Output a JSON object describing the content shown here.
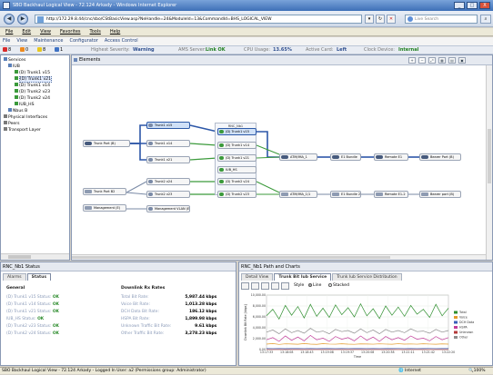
{
  "window": {
    "title": "SBO Backhaul Logical View - 72.124 Arkady - Windows Internet Explorer",
    "url": "http://172.29.8.44/cnc/sbo/CStBasicView.asp?NeHandle=24&ModuleId=13&CommandId=BHS_LOGICAL_VIEW",
    "search_placeholder": "Live Search",
    "controls": [
      "_",
      "□",
      "X"
    ]
  },
  "ie_menu": [
    "File",
    "Edit",
    "View",
    "Favorites",
    "Tools",
    "Help"
  ],
  "app_menu": [
    "File",
    "View",
    "Maintenance",
    "Configurator",
    "Access Control"
  ],
  "alarms": {
    "counts": [
      "8",
      "0",
      "8",
      "1"
    ],
    "highest_severity_label": "Highest Severity:",
    "highest_severity": "Warning",
    "ams_label": "AMS Server:",
    "ams_value": "Link OK",
    "cpu_label": "CPU Usage:",
    "cpu_value": "13.65%",
    "card_label": "Active Card:",
    "card_value": "Left",
    "device_label": "Clock Device:",
    "device_value": "Internal"
  },
  "tree": [
    {
      "label": "Services",
      "indent": 0
    },
    {
      "label": "IUB",
      "indent": 1
    },
    {
      "label": "(D) Trunk1 v15",
      "indent": 2
    },
    {
      "label": "(D) Trunk1 v21",
      "indent": 2,
      "selected": true
    },
    {
      "label": "(D) Trunk1 v14",
      "indent": 2
    },
    {
      "label": "(D) Trunk2 v23",
      "indent": 2
    },
    {
      "label": "(D) Trunk2 v24",
      "indent": 2
    },
    {
      "label": "IUB_HS",
      "indent": 2
    },
    {
      "label": "Nbus B",
      "indent": 1
    },
    {
      "label": "Physical Interfaces",
      "indent": 0
    },
    {
      "label": "Peers",
      "indent": 0
    },
    {
      "label": "Transport Layer",
      "indent": 0
    }
  ],
  "elements": {
    "title": "Elements",
    "cluster_title": "RNC_Nb1",
    "toolbar_icons": [
      "zoom-in-icon",
      "zoom-out-icon",
      "fit-icon",
      "layout-icon",
      "print-icon",
      "export-icon"
    ],
    "nodes": {
      "port_left_1": "Trunk Port (B)",
      "port_left_2": "Trunk Port B2",
      "mgmt": "Management (E)",
      "t1": "Trunk1 v15",
      "t2": "Trunk1 v14",
      "t3": "Trunk1 v21",
      "t4": "Trunk2 v24",
      "t5": "Trunk2 v23",
      "mgmt_vlan": "Management VLAN (E)",
      "c1": "(D) Trunk1 v15",
      "c2": "(D) Trunk1 v14",
      "c3": "(D) Trunk1 v21",
      "c4": "IUB_HS",
      "c5": "(D) Trunk2 v24",
      "c6": "(D) Trunk2 v23",
      "r1": "ATM/IMA_1",
      "r2": "E1 Bundle",
      "r3": "Remote E1",
      "r4": "Bearer Port (B)",
      "r5": "ATM/IMA_1/1",
      "r6": "E1 Bundle 2",
      "r7": "Remote E1-2",
      "r8": "Bearer port (B)"
    }
  },
  "status_panel": {
    "title": "RNC_Nb1 Status",
    "tabs": [
      "Alarms",
      "Status"
    ],
    "general_header": "General",
    "downlink_header": "Downlink Rx Rates",
    "general": [
      {
        "label": "(D) Trunk1 v15 Status:",
        "value": "OK"
      },
      {
        "label": "(D) Trunk1 v14 Status:",
        "value": "OK"
      },
      {
        "label": "(D) Trunk1 v21 Status:",
        "value": "OK"
      },
      {
        "label": "IUB_HS Status:",
        "value": "OK"
      },
      {
        "label": "(D) Trunk2 v23 Status:",
        "value": "OK"
      },
      {
        "label": "(D) Trunk2 v24 Status:",
        "value": "OK"
      }
    ],
    "downlink": [
      {
        "label": "Total Bit Rate:",
        "value": "5,987.44",
        "unit": "kbps"
      },
      {
        "label": "Voice Bit Rate:",
        "value": "1,013.28",
        "unit": "kbps"
      },
      {
        "label": "DCH Data Bit Rate:",
        "value": "186.12",
        "unit": "kbps"
      },
      {
        "label": "HSPA Bit Rate:",
        "value": "1,899.98",
        "unit": "kbps"
      },
      {
        "label": "Unknown Traffic Bit Rate:",
        "value": "9.61",
        "unit": "kbps"
      },
      {
        "label": "Other Traffic Bit Rate:",
        "value": "3,278.23",
        "unit": "kbps"
      }
    ]
  },
  "path_panel": {
    "title": "RNC_Nb1 Path and Charts",
    "tabs": [
      "Detail View",
      "Trunk Bit Iub Service",
      "Trunk Iub Service Distribution"
    ],
    "style_label": "Style",
    "line_label": "Line",
    "stacked_label": "Stacked"
  },
  "statusbar": {
    "text": "SBO Backhaul Logical View - 72.124 Arkady - Logged In User: a2 (Permissions group: Administrator)",
    "zone": "Internet",
    "zoom": "100%"
  },
  "chart_data": {
    "type": "line",
    "ylabel": "Downlink Bit Rate [kbps]",
    "xlabel": "Time",
    "ylim": [
      0,
      10000
    ],
    "y_ticks": [
      "10,000.00",
      "8,000.00",
      "6,000.00",
      "4,000.00",
      "2,000.00",
      "0.00"
    ],
    "x": [
      "13:17:33",
      "13:18:08",
      "13:18:43",
      "13:19:08",
      "13:19:37",
      "13:20:08",
      "13:20:38",
      "13:21:11",
      "13:21:42",
      "13:22:20"
    ],
    "series": [
      {
        "name": "Total",
        "color": "#2f8f2f",
        "values": [
          6200,
          7400,
          5600,
          8100,
          6300,
          7900,
          5800,
          8300,
          6100,
          7600,
          5900,
          8200,
          6400,
          7700,
          6000,
          8400,
          6200,
          7500,
          5700,
          8000,
          6300,
          7800,
          6100,
          8100,
          6500,
          7400,
          5900,
          8300,
          6200,
          7600
        ]
      },
      {
        "name": "Voice",
        "color": "#e49b2a",
        "values": [
          1000,
          1100,
          950,
          1050,
          1020,
          980,
          1100,
          1000,
          960,
          1080,
          1010,
          990,
          1060,
          1000,
          970,
          1040,
          1020,
          990,
          1050,
          1010,
          980,
          1070,
          1000,
          1030,
          990,
          1060,
          1010,
          980,
          1040,
          1000
        ]
      },
      {
        "name": "DCH Data",
        "color": "#3a5fb8",
        "values": [
          190,
          180,
          200,
          170,
          190,
          185,
          175,
          195,
          180,
          190,
          185,
          180,
          195,
          175,
          190,
          185,
          180,
          200,
          175,
          190,
          185,
          195,
          180,
          190,
          175,
          185,
          195,
          180,
          190,
          185
        ]
      },
      {
        "name": "HSPA",
        "color": "#c23c9a",
        "values": [
          1800,
          2200,
          1500,
          2500,
          1700,
          2300,
          1600,
          2600,
          1800,
          2100,
          1500,
          2400,
          1900,
          2200,
          1600,
          2500,
          1700,
          2300,
          1500,
          2400,
          1800,
          2200,
          1700,
          2500,
          1900,
          2100,
          1600,
          2400,
          1800,
          2200
        ]
      },
      {
        "name": "Unknown",
        "color": "#b43a3a",
        "values": [
          10,
          9,
          11,
          10,
          9,
          10,
          11,
          9,
          10,
          10,
          9,
          11,
          10,
          9,
          10,
          11,
          9,
          10,
          10,
          9,
          11,
          10,
          9,
          10,
          11,
          9,
          10,
          10,
          9,
          10
        ]
      },
      {
        "name": "Other",
        "color": "#8c8c8c",
        "values": [
          3200,
          3600,
          2900,
          3800,
          3100,
          3500,
          3000,
          3900,
          3200,
          3400,
          2900,
          3700,
          3300,
          3500,
          3000,
          3800,
          3100,
          3600,
          2900,
          3700,
          3200,
          3500,
          3100,
          3800,
          3300,
          3400,
          3000,
          3700,
          3200,
          3500
        ]
      }
    ]
  }
}
